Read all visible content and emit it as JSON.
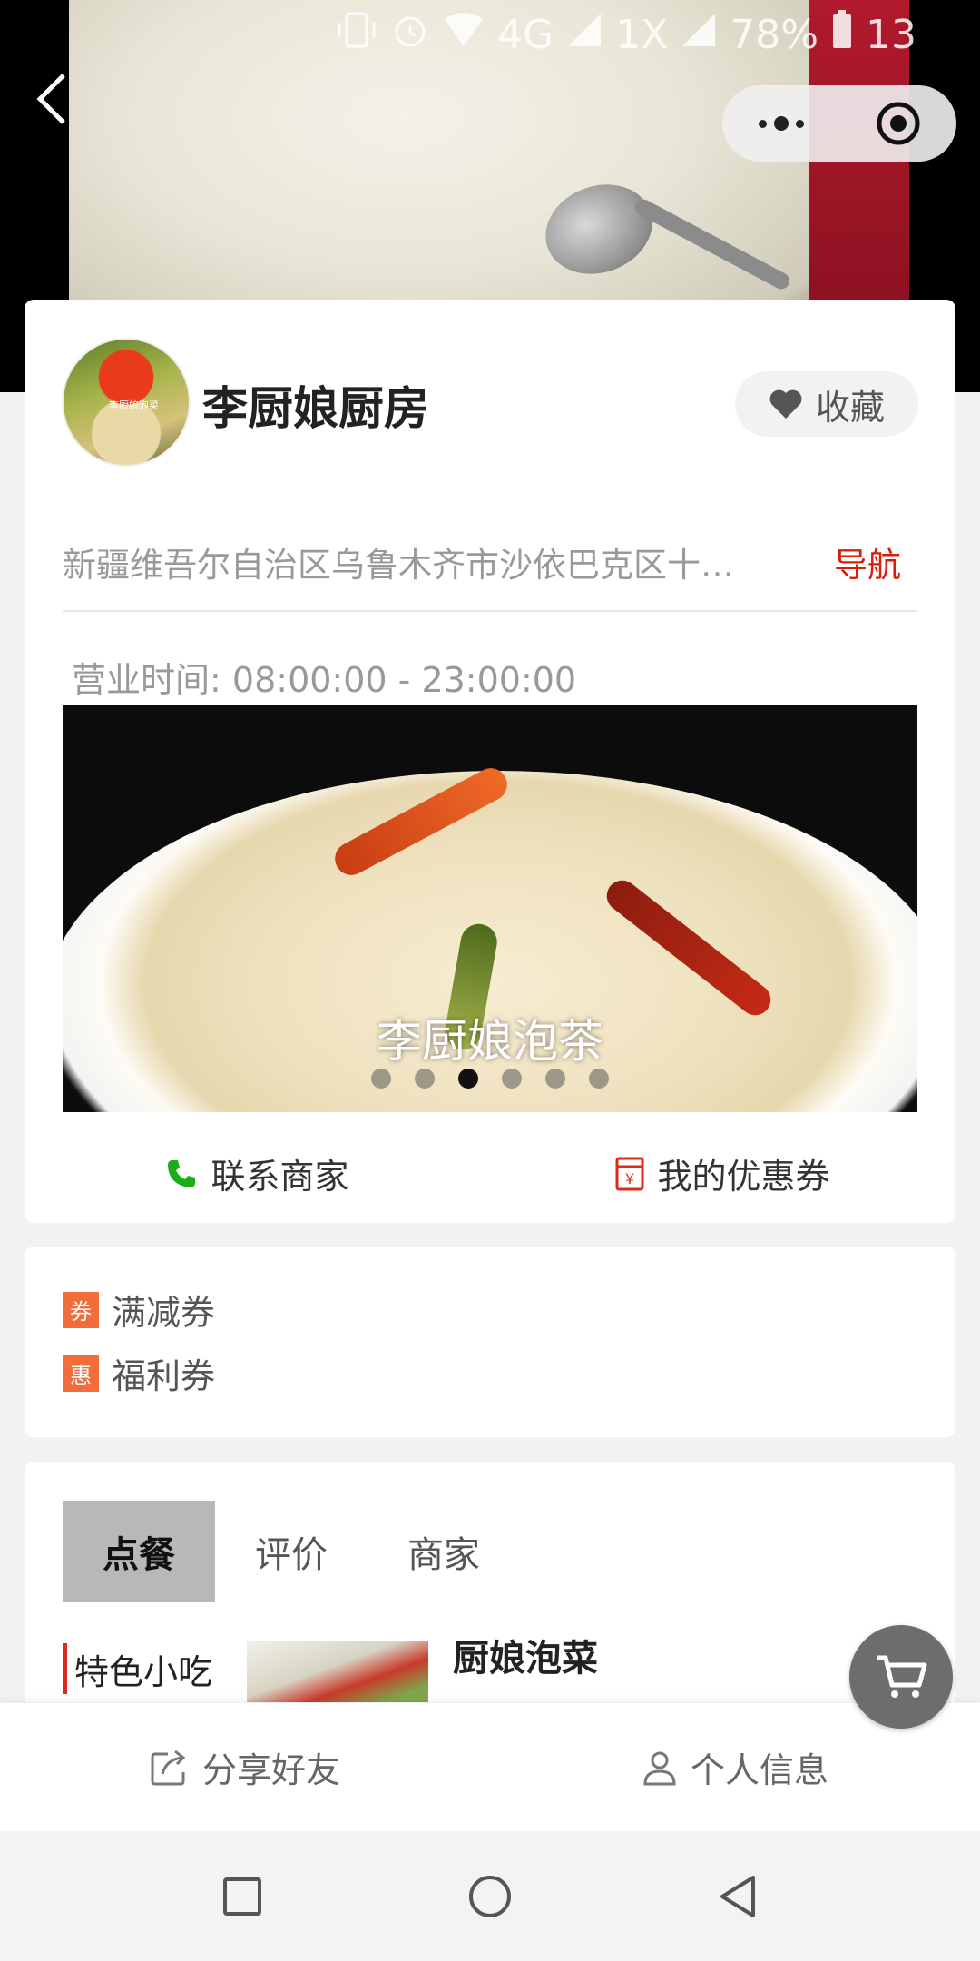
{
  "status_bar": {
    "network": "4G",
    "network2": "1X",
    "battery": "78%",
    "time": "13"
  },
  "header": {
    "back_icon": "chevron-left-icon",
    "menu_icon": "more-dots-icon",
    "target_icon": "target-icon"
  },
  "shop": {
    "name": "李厨娘厨房",
    "logo_text": "李厨娘泡菜",
    "favorite_label": "收藏",
    "address": "新疆维吾尔自治区乌鲁木齐市沙依巴克区十…",
    "nav_label": "导航",
    "hours_label": "营业时间:",
    "hours_value": "08:00:00 - 23:00:00",
    "carousel_caption": "李厨娘泡茶",
    "carousel_total": 6,
    "carousel_active_index": 2,
    "contact_label": "联系商家",
    "coupons_label": "我的优惠券"
  },
  "coupons": [
    {
      "tag": "券",
      "label": "满减券"
    },
    {
      "tag": "惠",
      "label": "福利券"
    }
  ],
  "menu": {
    "tabs": [
      {
        "label": "点餐",
        "active": true
      },
      {
        "label": "评价",
        "active": false
      },
      {
        "label": "商家",
        "active": false
      }
    ],
    "category": "特色小吃",
    "dish_name": "厨娘泡菜"
  },
  "bottom_bar": {
    "share_label": "分享好友",
    "profile_label": "个人信息"
  },
  "colors": {
    "accent_red": "#d81e06",
    "coupon_tag": "#f36c3b",
    "phone_green": "#1aad19"
  }
}
